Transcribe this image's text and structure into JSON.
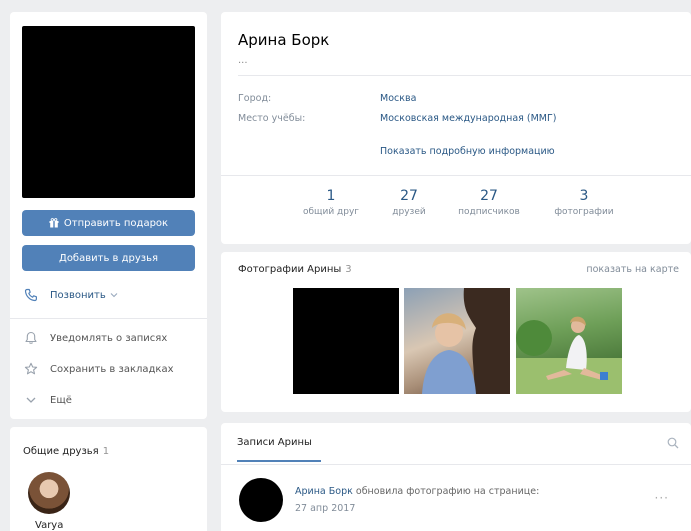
{
  "left": {
    "gift_button": "Отправить подарок",
    "add_button": "Добавить в друзья",
    "call": "Позвонить",
    "notify": "Уведомлять о записях",
    "bookmark": "Сохранить в закладках",
    "more": "Ещё"
  },
  "common_friends": {
    "title": "Общие друзья",
    "count": "1",
    "friend_name": "Varya"
  },
  "profile": {
    "name": "Арина Борк",
    "status": "...",
    "city_label": "Город:",
    "city_value": "Москва",
    "study_label": "Место учёбы:",
    "study_value": "Московская международная (ММГ)",
    "show_more": "Показать подробную информацию",
    "stats": [
      {
        "num": "1",
        "label": "общий друг"
      },
      {
        "num": "27",
        "label": "друзей"
      },
      {
        "num": "27",
        "label": "подписчиков"
      },
      {
        "num": "3",
        "label": "фотографии"
      }
    ]
  },
  "photos": {
    "title": "Фотографии Арины",
    "count": "3",
    "map_link": "показать на карте"
  },
  "wall": {
    "tab": "Записи Арины",
    "post_author": "Арина Борк",
    "post_action": "обновила фотографию на странице:",
    "post_date": "27 апр 2017",
    "post_more": "···"
  },
  "colors": {
    "accent": "#5181b8",
    "link": "#2a5885",
    "background": "#edeef0"
  }
}
